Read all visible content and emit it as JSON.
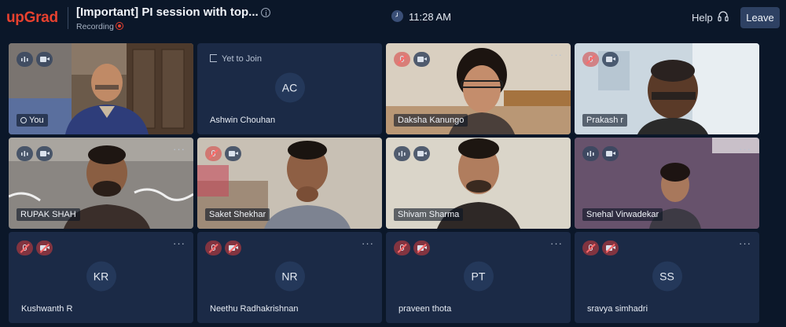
{
  "header": {
    "logo": "upGrad",
    "title": "[Important] PI session with top...",
    "recording_label": "Recording",
    "time": "11:28 AM",
    "help_label": "Help",
    "leave_label": "Leave"
  },
  "participants": [
    {
      "name": "You",
      "type": "video"
    },
    {
      "name": "Ashwin Chouhan",
      "initials": "AC",
      "status": "Yet to Join",
      "type": "avatar"
    },
    {
      "name": "Daksha Kanungo",
      "type": "video"
    },
    {
      "name": "Prakash r",
      "type": "video"
    },
    {
      "name": "RUPAK SHAH",
      "type": "video"
    },
    {
      "name": "Saket Shekhar",
      "type": "video"
    },
    {
      "name": "Shivam Sharma",
      "type": "video"
    },
    {
      "name": "Snehal Virwadekar",
      "type": "video"
    },
    {
      "name": "Kushwanth R",
      "initials": "KR",
      "type": "avatar"
    },
    {
      "name": "Neethu Radhakrishnan",
      "initials": "NR",
      "type": "avatar"
    },
    {
      "name": "praveen thota",
      "initials": "PT",
      "type": "avatar"
    },
    {
      "name": "sravya simhadri",
      "initials": "SS",
      "type": "avatar"
    }
  ],
  "more_label": "···",
  "colors": {
    "brand": "#e8412f",
    "background": "#0b1729",
    "tile": "#1b2a46",
    "leave_button": "#2e4163"
  }
}
